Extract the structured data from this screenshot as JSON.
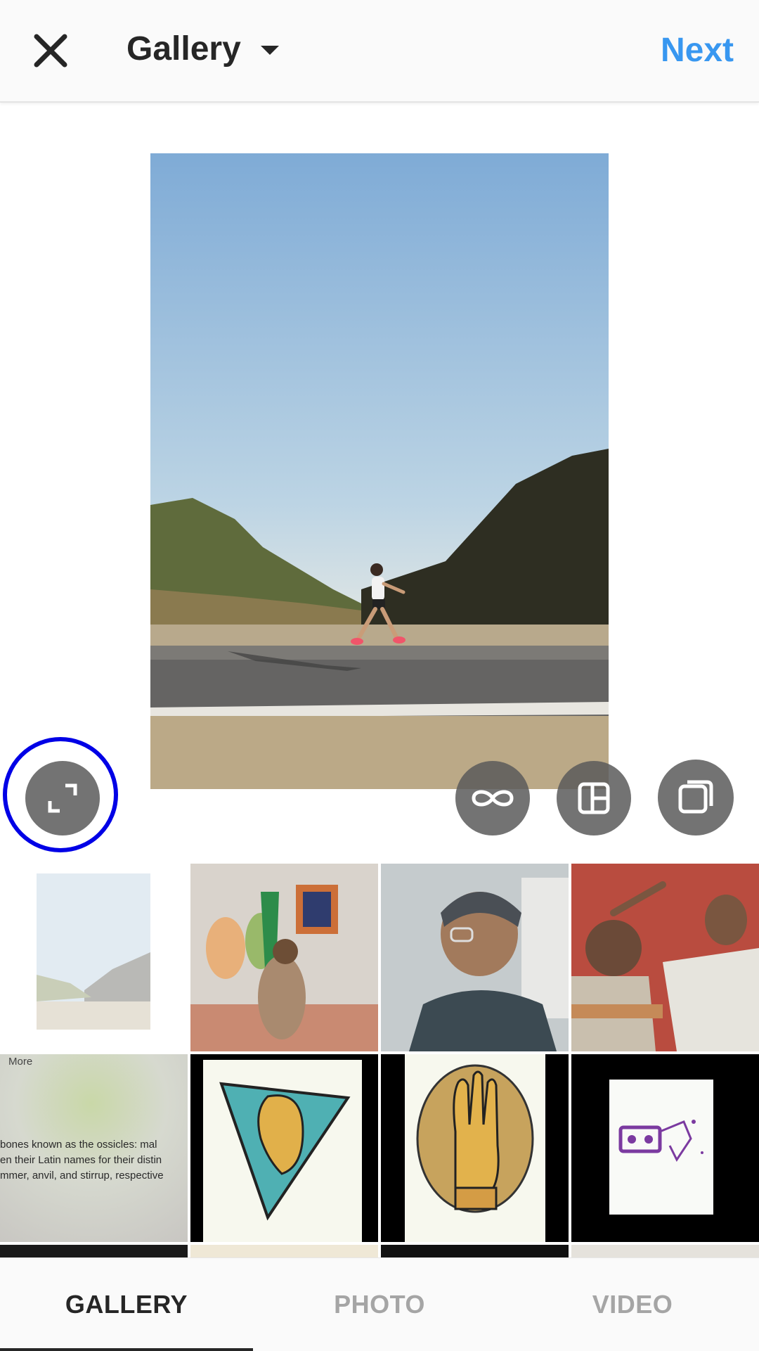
{
  "header": {
    "title": "Gallery",
    "next_label": "Next"
  },
  "preview": {
    "image_icon": "photo-woman-walking-road"
  },
  "tools": {
    "expand_icon": "expand-icon",
    "boomerang_icon": "infinity-icon",
    "layout_icon": "layout-icon",
    "multi_select_icon": "multi-select-icon"
  },
  "grid": {
    "thumbnails": [
      "road-walker-thumbnail",
      "wall-painting-bat-thumbnail",
      "man-glasses-thumbnail",
      "two-men-talking-thumbnail",
      "screen-text-thumbnail",
      "triangle-head-art-thumbnail",
      "hand-oval-art-thumbnail",
      "cassette-sketch-thumbnail"
    ],
    "screen_text": {
      "more": "More",
      "line1": "bones known as the ossicles: mal",
      "line2": "en their Latin names for their distin",
      "line3": "mmer, anvil, and stirrup, respective"
    }
  },
  "tabs": [
    {
      "label": "GALLERY",
      "active": true
    },
    {
      "label": "PHOTO",
      "active": false
    },
    {
      "label": "VIDEO",
      "active": false
    }
  ],
  "colors": {
    "accent": "#3897f0",
    "highlight_ring": "#0000e6"
  }
}
